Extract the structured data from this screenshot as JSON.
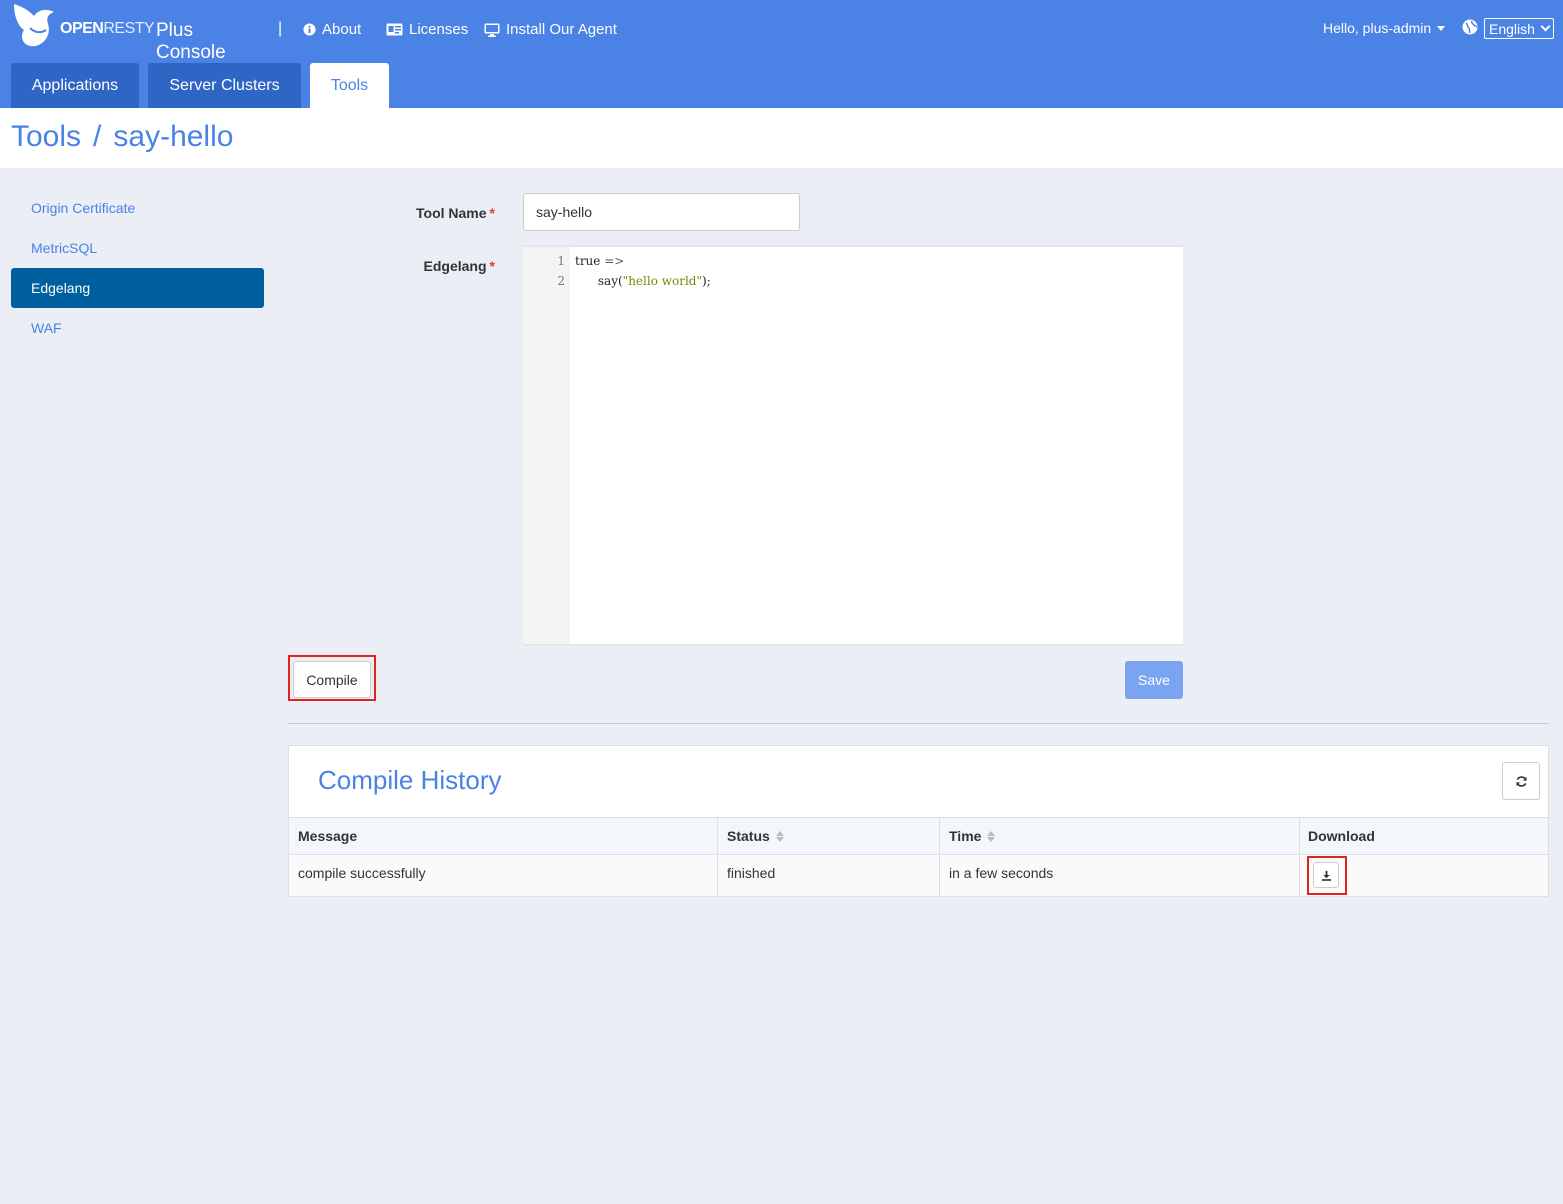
{
  "header": {
    "logo_bold": "OPEN",
    "logo_light": "RESTY",
    "product": "Plus Console",
    "separator": "|",
    "nav": [
      {
        "label": "About",
        "icon": "info-icon"
      },
      {
        "label": "Licenses",
        "icon": "id-card-icon"
      },
      {
        "label": "Install Our Agent",
        "icon": "monitor-icon"
      }
    ],
    "user_label": "Hello, plus-admin",
    "language": "English"
  },
  "tabs": [
    {
      "label": "Applications",
      "active": false
    },
    {
      "label": "Server Clusters",
      "active": false
    },
    {
      "label": "Tools",
      "active": true
    }
  ],
  "breadcrumb": {
    "root": "Tools",
    "sep": "/",
    "current": "say-hello"
  },
  "sidebar": {
    "items": [
      {
        "label": "Origin Certificate",
        "active": false
      },
      {
        "label": "MetricSQL",
        "active": false
      },
      {
        "label": "Edgelang",
        "active": true
      },
      {
        "label": "WAF",
        "active": false
      }
    ]
  },
  "form": {
    "tool_name_label": "Tool Name",
    "tool_name_value": "say-hello",
    "edgelang_label": "Edgelang",
    "required_mark": "*",
    "code_lines": [
      {
        "num": "1",
        "kw": "true",
        "op": " =>",
        "rest": ""
      },
      {
        "num": "2",
        "fn": "      say(",
        "str": "\"hello world\"",
        "end": ");"
      }
    ],
    "compile_label": "Compile",
    "save_label": "Save"
  },
  "history": {
    "title": "Compile History",
    "columns": [
      "Message",
      "Status",
      "Time",
      "Download"
    ],
    "rows": [
      {
        "message": "compile successfully",
        "status": "finished",
        "time": "in a few seconds"
      }
    ]
  },
  "colors": {
    "header_blue": "#4a82e6",
    "tab_dark": "#2f65c4",
    "sidebar_active": "#005f9e",
    "highlight_red": "#e0241b"
  }
}
